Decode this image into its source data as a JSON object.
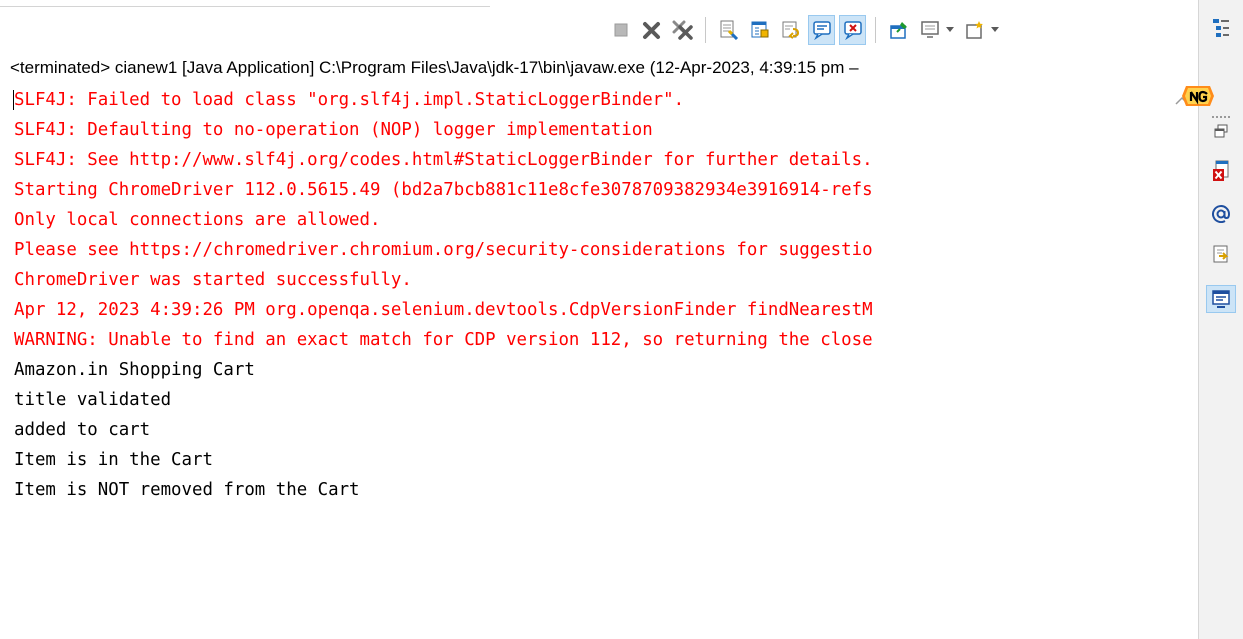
{
  "toolbar": {
    "buttons": [
      {
        "icon": "terminate-icon",
        "pressed": false
      },
      {
        "icon": "remove-launch-icon",
        "pressed": false
      },
      {
        "icon": "remove-all-terminated-icon",
        "pressed": false
      },
      {
        "icon": "clear-console-icon",
        "pressed": false
      },
      {
        "icon": "scroll-lock-icon",
        "pressed": false
      },
      {
        "icon": "word-wrap-icon",
        "pressed": false
      },
      {
        "icon": "show-on-stdout-icon",
        "pressed": true
      },
      {
        "icon": "show-on-stderr-icon",
        "pressed": true
      },
      {
        "icon": "pin-console-icon",
        "pressed": false
      },
      {
        "icon": "display-console-icon",
        "pressed": false
      },
      {
        "icon": "open-console-icon",
        "pressed": false
      }
    ]
  },
  "header": {
    "process_label": "<terminated> cianew1 [Java Application] C:\\Program Files\\Java\\jdk-17\\bin\\javaw.exe  (12-Apr-2023, 4:39:15 pm –"
  },
  "console": {
    "lines": [
      {
        "text": "SLF4J: Failed to load class \"org.slf4j.impl.StaticLoggerBinder\".",
        "stream": "err"
      },
      {
        "text": "SLF4J: Defaulting to no-operation (NOP) logger implementation",
        "stream": "err"
      },
      {
        "text": "SLF4J: See http://www.slf4j.org/codes.html#StaticLoggerBinder for further details.",
        "stream": "err"
      },
      {
        "text": "Starting ChromeDriver 112.0.5615.49 (bd2a7bcb881c11e8cfe3078709382934e3916914-refs",
        "stream": "err"
      },
      {
        "text": "Only local connections are allowed.",
        "stream": "err"
      },
      {
        "text": "Please see https://chromedriver.chromium.org/security-considerations for suggestio",
        "stream": "err"
      },
      {
        "text": "ChromeDriver was started successfully.",
        "stream": "err"
      },
      {
        "text": "Apr 12, 2023 4:39:26 PM org.openqa.selenium.devtools.CdpVersionFinder findNearestM",
        "stream": "err"
      },
      {
        "text": "WARNING: Unable to find an exact match for CDP version 112, so returning the close",
        "stream": "err"
      },
      {
        "text": "Amazon.in Shopping Cart",
        "stream": "out"
      },
      {
        "text": "title validated",
        "stream": "out"
      },
      {
        "text": "added to cart",
        "stream": "out"
      },
      {
        "text": "Item is in the Cart",
        "stream": "out"
      },
      {
        "text": "Item is NOT removed from the Cart",
        "stream": "out"
      }
    ]
  },
  "sidebar": {
    "icons": [
      {
        "icon": "outline-view-icon",
        "active": false
      },
      {
        "icon": "restore-view-icon",
        "active": false
      },
      {
        "icon": "problems-view-icon",
        "active": false
      },
      {
        "icon": "javadoc-view-icon",
        "active": false
      },
      {
        "icon": "declaration-view-icon",
        "active": false
      },
      {
        "icon": "console-view-icon",
        "active": true
      }
    ]
  },
  "colors": {
    "stderr": "#ff0000",
    "stdout": "#000000",
    "pressed_bg": "#cce4f7",
    "pressed_border": "#99c9ef"
  }
}
